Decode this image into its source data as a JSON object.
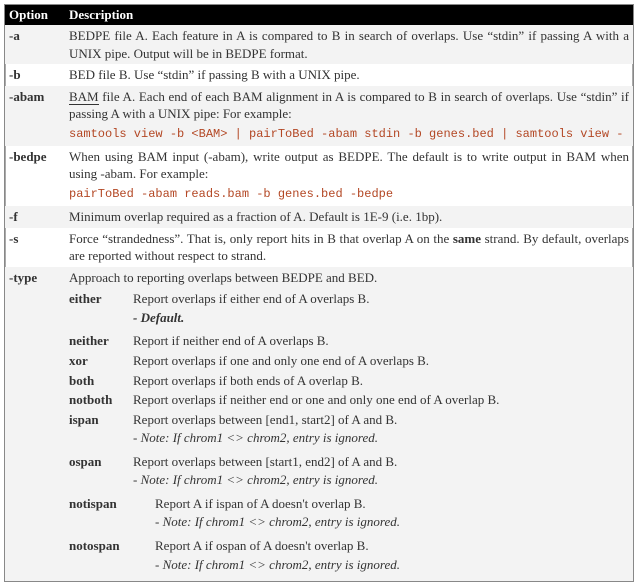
{
  "headers": {
    "option": "Option",
    "description": "Description"
  },
  "rows": {
    "a": {
      "opt": "-a",
      "desc": "BEDPE file A.  Each feature in A is compared to B in search of overlaps.  Use “stdin” if passing A with a UNIX pipe.  Output will be in BEDPE format."
    },
    "b": {
      "opt": "-b",
      "desc": "BED file B. Use “stdin” if passing B with a UNIX pipe."
    },
    "abam": {
      "opt": "-abam",
      "desc_prefix": "BAM",
      "desc_rest": " file A. Each end of each BAM alignment in A is compared to B in search of overlaps.  Use “stdin” if passing A with a UNIX pipe: For example:",
      "code": "samtools view -b <BAM> | pairToBed -abam stdin -b genes.bed | samtools view -"
    },
    "bedpe": {
      "opt": "-bedpe",
      "desc": "When using BAM input (-abam), write output as BEDPE. The default is to write output in BAM when using -abam. For example:",
      "code": "pairToBed -abam reads.bam -b genes.bed -bedpe"
    },
    "f": {
      "opt": "-f",
      "desc": "Minimum overlap required as a fraction of A. Default is 1E-9 (i.e. 1bp)."
    },
    "s": {
      "opt": "-s",
      "desc_pre": "Force “strandedness”.  That is, only report hits in B that overlap A on the ",
      "desc_bold": "same",
      "desc_post": " strand. By default, overlaps are reported without respect to strand."
    },
    "type": {
      "opt": "-type",
      "desc": "Approach to reporting overlaps between BEDPE and BED.",
      "either": {
        "key": "either",
        "val": "Report overlaps if either end of A overlaps B.",
        "note": "- Default."
      },
      "neither": {
        "key": "neither",
        "val": "Report if neither end of A overlaps B."
      },
      "xor": {
        "key": "xor",
        "val": "Report overlaps if one and only one end of A overlaps B."
      },
      "both": {
        "key": "both",
        "val": "Report overlaps if both ends of A overlap  B."
      },
      "notboth": {
        "key": "notboth",
        "val": "Report overlaps if neither end or one and only one end of A overlap  B."
      },
      "ispan": {
        "key": "ispan",
        "val": "Report overlaps between [end1, start2] of A and B.",
        "note": "- Note: If chrom1 <> chrom2, entry is ignored."
      },
      "ospan": {
        "key": "ospan",
        "val": "Report overlaps between [start1, end2] of A and B.",
        "note": "- Note: If chrom1 <> chrom2, entry is ignored."
      },
      "notispan": {
        "key": "notispan",
        "val": "Report A if ispan of A doesn't overlap B.",
        "note": "- Note: If chrom1 <> chrom2, entry is ignored."
      },
      "notospan": {
        "key": "notospan",
        "val": "Report A if ospan of A doesn't overlap B.",
        "note": "- Note: If chrom1 <> chrom2, entry is ignored."
      }
    }
  }
}
